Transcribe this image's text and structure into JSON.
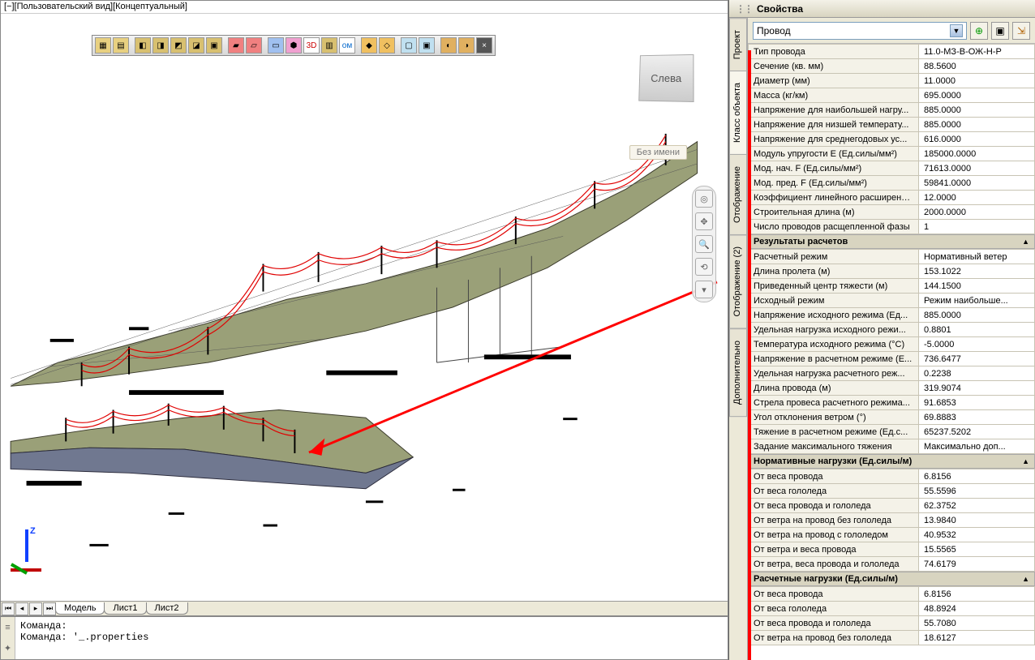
{
  "window": {
    "title": "[−][Пользовательский вид][Концептуальный]"
  },
  "navcube": {
    "label": "Слева"
  },
  "badge": {
    "text": "Без имени"
  },
  "bottom_tabs": {
    "items": [
      "Модель",
      "Лист1",
      "Лист2"
    ],
    "active": 0
  },
  "cmd": {
    "line1": "Команда:",
    "line2": "Команда: '_.properties"
  },
  "properties": {
    "title": "Свойства",
    "selector": "Провод",
    "side_tabs": [
      "Проект",
      "Класс объекта",
      "Отображение",
      "Отображение (2)",
      "Дополнительно"
    ],
    "group_main": [
      {
        "k": "Тип провода",
        "v": "11.0-МЗ-В-ОЖ-Н-Р"
      },
      {
        "k": "Сечение (кв. мм)",
        "v": "88.5600"
      },
      {
        "k": "Диаметр (мм)",
        "v": "11.0000"
      },
      {
        "k": "Масса (кг/км)",
        "v": "695.0000"
      },
      {
        "k": "Напряжение для наибольшей нагру...",
        "v": "885.0000"
      },
      {
        "k": "Напряжение для низшей температу...",
        "v": "885.0000"
      },
      {
        "k": "Напряжение для среднегодовых ус...",
        "v": "616.0000"
      },
      {
        "k": "Модуль упругости E (Ед.силы/мм²)",
        "v": "185000.0000"
      },
      {
        "k": "Мод. нач. F (Ед.силы/мм²)",
        "v": "71613.0000"
      },
      {
        "k": "Мод. пред. F (Ед.силы/мм²)",
        "v": "59841.0000"
      },
      {
        "k": "Коэффициент линейного расширени...",
        "v": "12.0000"
      },
      {
        "k": "Строительная длина (м)",
        "v": "2000.0000"
      },
      {
        "k": "Число проводов расщепленной фазы",
        "v": "1"
      }
    ],
    "header_results": "Результаты расчетов",
    "group_results": [
      {
        "k": "Расчетный режим",
        "v": "Нормативный ветер"
      },
      {
        "k": "Длина пролета (м)",
        "v": "153.1022"
      },
      {
        "k": "Приведенный центр тяжести (м)",
        "v": "144.1500"
      },
      {
        "k": "Исходный режим",
        "v": "Режим наибольше..."
      },
      {
        "k": "Напряжение исходного режима (Ед...",
        "v": "885.0000"
      },
      {
        "k": "Удельная нагрузка исходного режи...",
        "v": "0.8801"
      },
      {
        "k": "Температура исходного режима (°C)",
        "v": "-5.0000"
      },
      {
        "k": "Напряжение в расчетном режиме (Е...",
        "v": "736.6477"
      },
      {
        "k": "Удельная нагрузка расчетного реж...",
        "v": "0.2238"
      },
      {
        "k": "Длина провода (м)",
        "v": "319.9074"
      },
      {
        "k": "Стрела провеса расчетного режима...",
        "v": "91.6853"
      },
      {
        "k": "Угол отклонения ветром (°)",
        "v": "69.8883"
      },
      {
        "k": "Тяжение в расчетном режиме (Ед.с...",
        "v": "65237.5202"
      },
      {
        "k": "Задание максимального тяжения",
        "v": "Максимально доп..."
      }
    ],
    "header_norm": "Нормативные нагрузки (Ед.силы/м)",
    "group_norm": [
      {
        "k": "От веса провода",
        "v": "6.8156"
      },
      {
        "k": "От веса гололеда",
        "v": "55.5596"
      },
      {
        "k": "От веса провода и гололеда",
        "v": "62.3752"
      },
      {
        "k": "От ветра на провод без гололеда",
        "v": "13.9840"
      },
      {
        "k": "От ветра на провод с гололедом",
        "v": "40.9532"
      },
      {
        "k": "От ветра и веса провода",
        "v": "15.5565"
      },
      {
        "k": "От ветра, веса провода и гололеда",
        "v": "74.6179"
      }
    ],
    "header_calc": "Расчетные нагрузки (Ед.силы/м)",
    "group_calc": [
      {
        "k": "От веса провода",
        "v": "6.8156"
      },
      {
        "k": "От веса гололеда",
        "v": "48.8924"
      },
      {
        "k": "От веса провода и гололеда",
        "v": "55.7080"
      },
      {
        "k": "От ветра на провод без гололеда",
        "v": "18.6127"
      }
    ]
  }
}
